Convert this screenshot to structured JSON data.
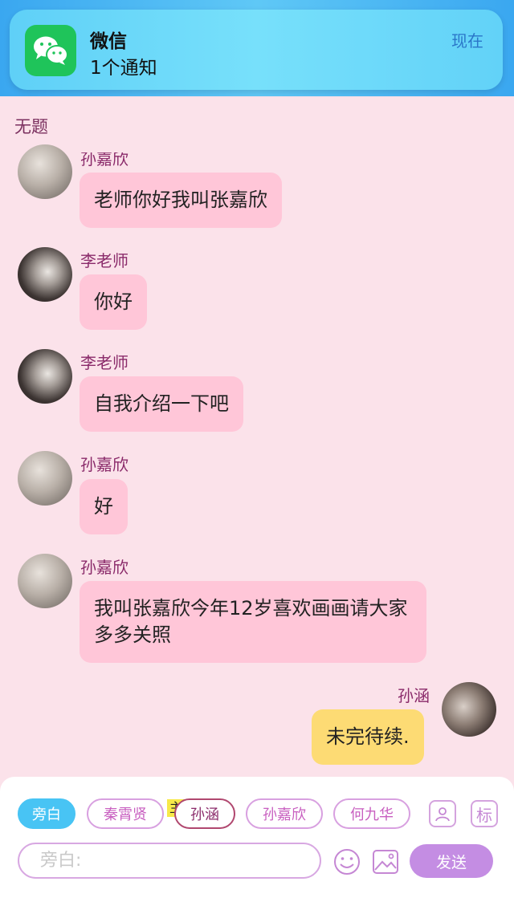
{
  "notification": {
    "app": "微信",
    "message": "1个通知",
    "time": "现在",
    "icon": "wechat-icon"
  },
  "topic": "无题",
  "messages": [
    {
      "sender": "孙嘉欣",
      "text": "老师你好我叫张嘉欣"
    },
    {
      "sender": "李老师",
      "text": "你好"
    },
    {
      "sender": "李老师",
      "text": "自我介绍一下吧"
    },
    {
      "sender": "孙嘉欣",
      "text": "好"
    },
    {
      "sender": "孙嘉欣",
      "text": "我叫张嘉欣今年12岁喜欢画画请大家多多关照"
    },
    {
      "sender": "孙涵",
      "text": "未完待续."
    }
  ],
  "roles": {
    "narration": "旁白",
    "r1": "秦霄贤",
    "r2": "孙涵",
    "r2_tag": "主",
    "r3": "孙嘉欣",
    "r4": "何九华",
    "label_btn": "标"
  },
  "input": {
    "placeholder": "旁白:"
  },
  "send_label": "发送",
  "colors": {
    "accent": "#48c4f4",
    "bubble_other": "#ffc6d8",
    "bubble_me": "#fddb74",
    "send": "#c48de3"
  }
}
